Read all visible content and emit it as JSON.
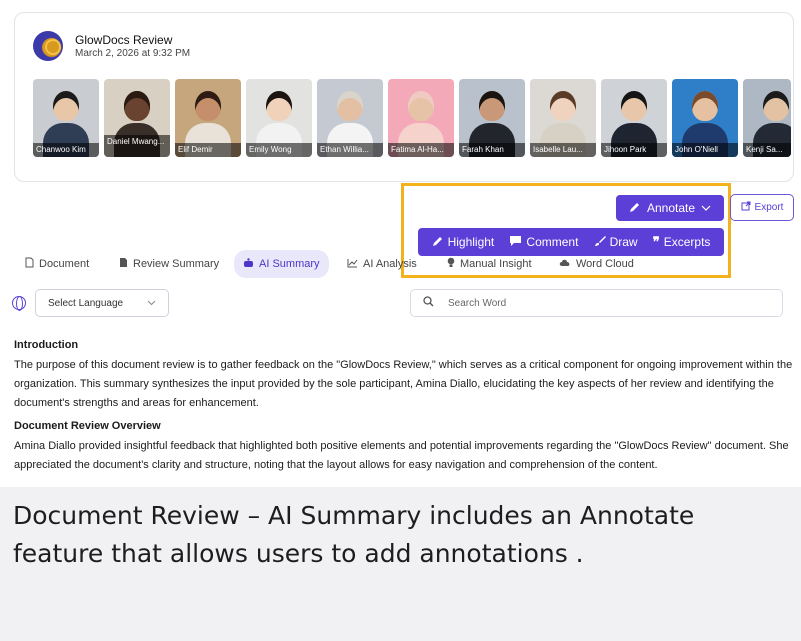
{
  "header": {
    "title": "GlowDocs Review",
    "date": "March 2, 2026 at 9:32 PM"
  },
  "participants": [
    {
      "name": "Chanwoo Kim",
      "skin": "#e8c6a8",
      "hair": "#1b1b1b",
      "shirt": "#2f3d55",
      "bg": "#c9ccd1"
    },
    {
      "name": "Daniel Mwang...",
      "skin": "#6a4330",
      "hair": "#2a1a12",
      "shirt": "#3a2e28",
      "bg": "#d8d0c2"
    },
    {
      "name": "Elif Demir",
      "skin": "#c68f6b",
      "hair": "#2c1c14",
      "shirt": "#e8e2d8",
      "bg": "#c6a67c"
    },
    {
      "name": "Emily Wong",
      "skin": "#f0d2bb",
      "hair": "#1c1410",
      "shirt": "#f2f2f2",
      "bg": "#e2e2e0"
    },
    {
      "name": "Ethan Willia...",
      "skin": "#e3c0a3",
      "hair": "#d9d5cc",
      "shirt": "#f4f4f4",
      "bg": "#c5cad2"
    },
    {
      "name": "Fatima Al-Ha...",
      "skin": "#e6c2a6",
      "hair": "#f0c9c3",
      "shirt": "#f6d2cc",
      "bg": "#f3a9b8"
    },
    {
      "name": "Farah Khan",
      "skin": "#c89878",
      "hair": "#1a1410",
      "shirt": "#23252c",
      "bg": "#b9c1cc"
    },
    {
      "name": "Isabelle Lau...",
      "skin": "#efd3be",
      "hair": "#5a3b28",
      "shirt": "#d7d0c4",
      "bg": "#dcd9d4"
    },
    {
      "name": "Jihoon Park",
      "skin": "#e7c6aa",
      "hair": "#151515",
      "shirt": "#1e2430",
      "bg": "#cfd3d8"
    },
    {
      "name": "John O'Niell",
      "skin": "#e6c1a1",
      "hair": "#7a4a2c",
      "shirt": "#1f3a6d",
      "bg": "#2f7fc8"
    },
    {
      "name": "Kenji Sa...",
      "skin": "#e3c2a4",
      "hair": "#1b1b1b",
      "shirt": "#232a36",
      "bg": "#aeb8c4"
    }
  ],
  "toolbar": {
    "annotate_label": "Annotate",
    "export_label": "Export",
    "menu": [
      {
        "label": "Highlight",
        "icon": "pen-icon"
      },
      {
        "label": "Comment",
        "icon": "comment-icon"
      },
      {
        "label": "Draw",
        "icon": "brush-icon"
      },
      {
        "label": "Excerpts",
        "icon": "quote-icon"
      }
    ],
    "accent": "#5b3fd6",
    "highlight_border": "#f3b21b"
  },
  "tabs": [
    {
      "label": "Document",
      "icon": "document-icon"
    },
    {
      "label": "Review Summary",
      "icon": "summary-icon"
    },
    {
      "label": "AI Summary",
      "icon": "ai-icon",
      "active": true
    },
    {
      "label": "AI Analysis",
      "icon": "chart-icon"
    },
    {
      "label": "Manual Insight",
      "icon": "bulb-icon"
    },
    {
      "label": "Word Cloud",
      "icon": "cloud-icon"
    }
  ],
  "filters": {
    "language_placeholder": "Select Language",
    "search_placeholder": "Search Word"
  },
  "content": {
    "intro_heading": "Introduction",
    "intro_text": "The purpose of this document review is to gather feedback on the \"GlowDocs Review,\" which serves as a critical component for ongoing improvement within the organization. This summary synthesizes the input provided by the sole participant, Amina Diallo, elucidating the key aspects of her review and identifying the document's strengths and areas for enhancement.",
    "overview_heading": "Document Review Overview",
    "overview_text": "Amina Diallo provided insightful feedback that highlighted both positive elements and potential improvements regarding the \"GlowDocs Review\" document. She appreciated the document's clarity and structure, noting that the layout allows for easy navigation and comprehension of the content."
  },
  "caption": "Document Review – AI Summary includes an Annotate feature that allows users to add annotations ."
}
